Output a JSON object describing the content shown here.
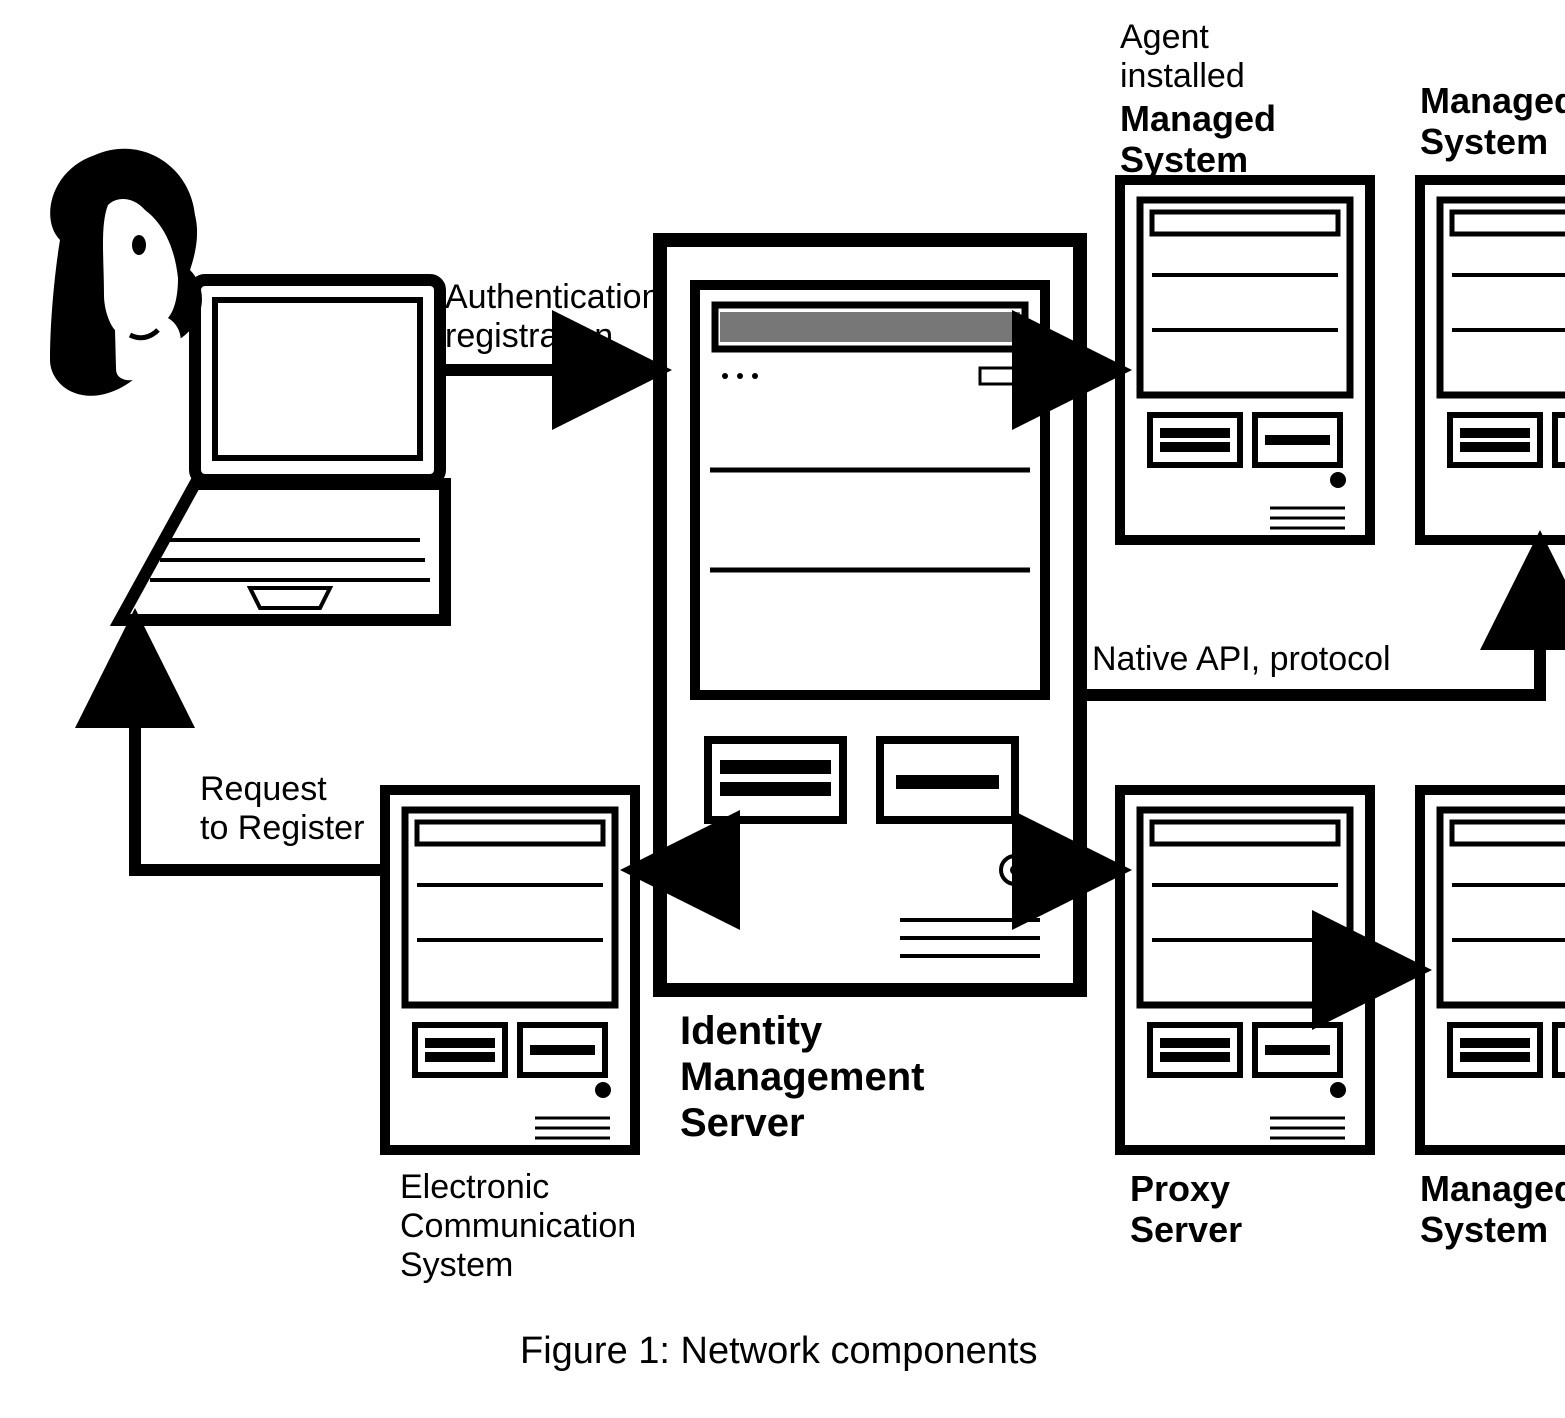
{
  "labels": {
    "agent_installed": "Agent\ninstalled",
    "managed_system_top1": "Managed\nSystem",
    "managed_system_top2": "Managed\nSystem",
    "authentication": "Authentication,\nregistration",
    "native_api": "Native API, protocol",
    "request": "Request\nto Register",
    "identity_server": "Identity\nManagement\nServer",
    "ecs": "Electronic\nCommunication\nSystem",
    "proxy_server": "Proxy\nServer",
    "managed_system_bottom": "Managed\nSystem",
    "caption": "Figure 1: Network components"
  }
}
